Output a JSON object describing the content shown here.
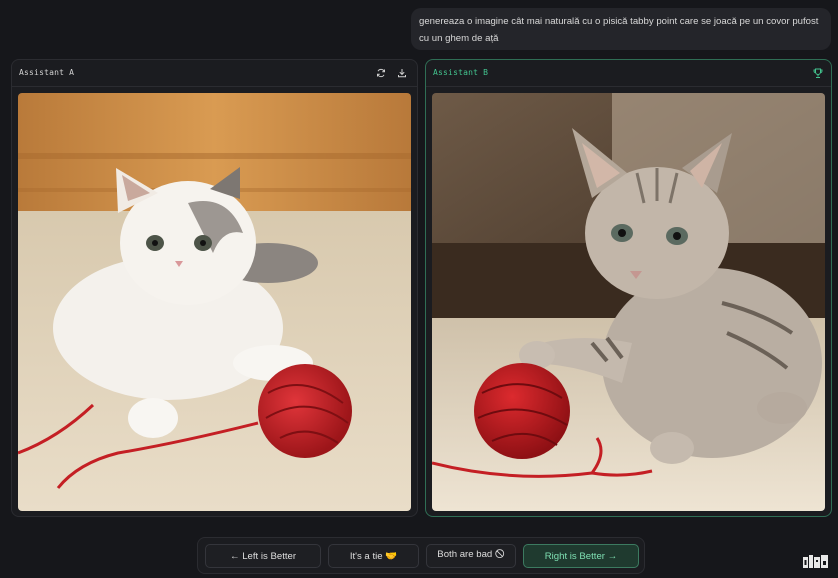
{
  "prompt": {
    "text": "genereaza o imagine cât mai naturală cu o pisică tabby point care se joacă pe un covor pufost cu un ghem de ață"
  },
  "panels": {
    "left": {
      "title": "Assistant A",
      "icons": [
        "refresh-icon",
        "download-icon"
      ],
      "image_alt": "White kitten with tabby point markings playing with red yarn ball on a cream shag rug"
    },
    "right": {
      "title": "Assistant B",
      "icons": [
        "trophy-icon"
      ],
      "image_alt": "Gray tabby kitten pawing a red yarn ball on a cream shag rug"
    }
  },
  "vote": {
    "left_label": "← Left is Better",
    "tie_label": "It's a tie 🤝",
    "bad_label": "Both are bad 🛇",
    "right_label": "Right is Better →"
  },
  "logo": "lmsys-logo-icon",
  "colors": {
    "background": "#16171b",
    "accent_green": "#43c48f",
    "panel_border_selected": "#2f6e55"
  }
}
